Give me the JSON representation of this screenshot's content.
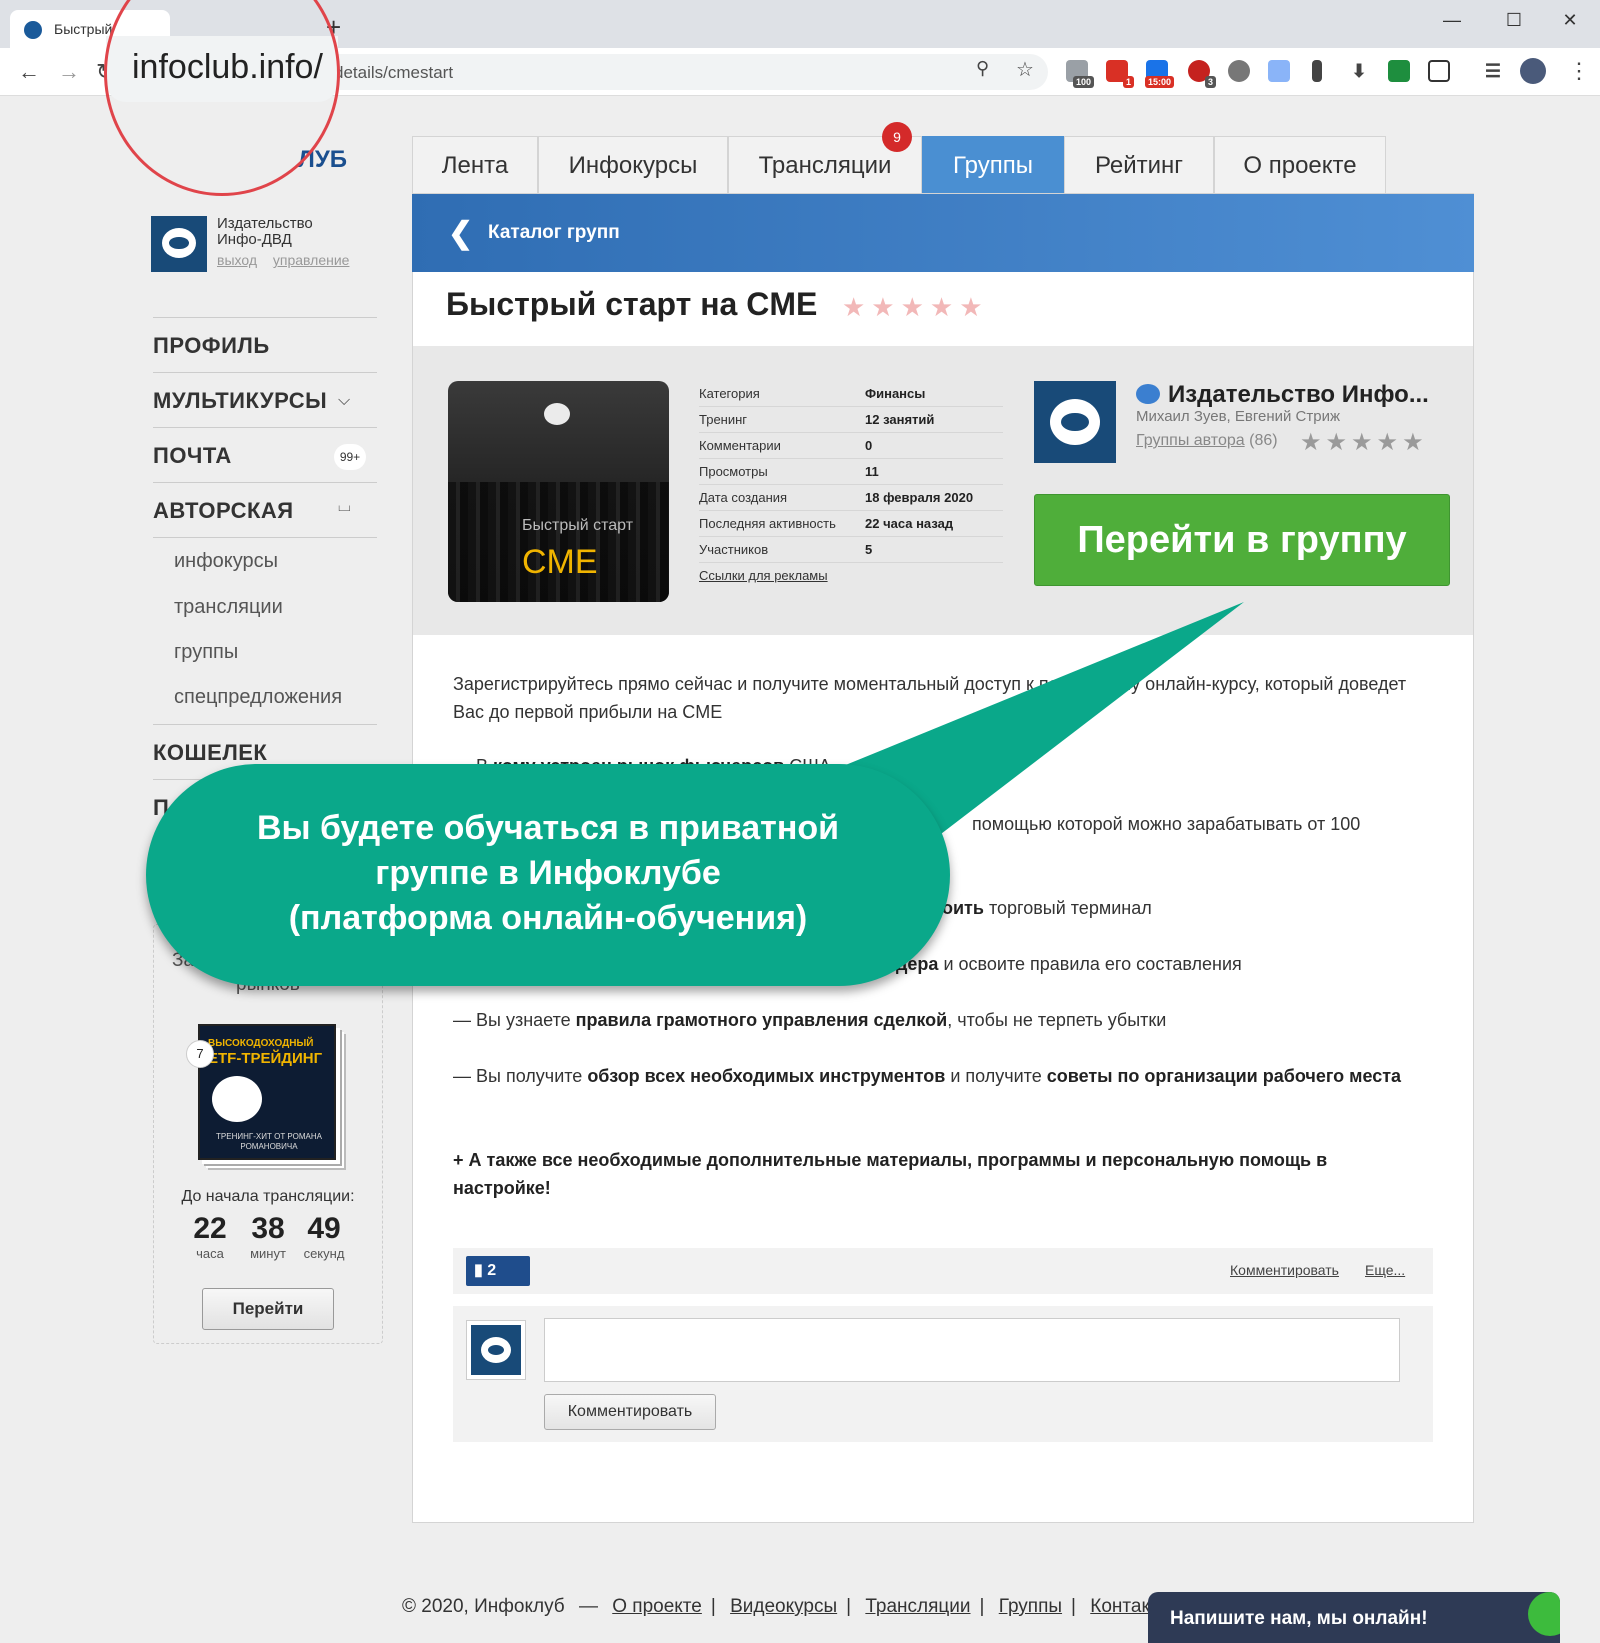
{
  "browser": {
    "tab_title": "Быстрый",
    "new_tab": "+",
    "url_partial": "details/cmestart",
    "zoomed_url": "infoclub.info/",
    "extensions": [
      {
        "name": "counter-100",
        "badge": "100",
        "color": "#9aa0a6"
      },
      {
        "name": "gmail",
        "badge": "1",
        "color": "#d93025"
      },
      {
        "name": "calendar",
        "badge": "15:00",
        "color": "#d93025"
      },
      {
        "name": "adblock",
        "badge": "3",
        "color": "#c5221f"
      }
    ]
  },
  "site": {
    "logo_suffix": "ЛУБ",
    "account_name": "Издательство Инфо-ДВД",
    "logout": "выход",
    "manage": "управление"
  },
  "sidebar": {
    "profile": "ПРОФИЛЬ",
    "multicourses": "МУЛЬТИКУРСЫ",
    "mail": "ПОЧТА",
    "mail_badge": "99+",
    "author": "АВТОРСКАЯ",
    "sub_items": [
      "инфокурсы",
      "трансляции",
      "группы",
      "спецпредложения"
    ],
    "wallet": "КОШЕЛЕК",
    "next_cut": "П"
  },
  "promo": {
    "title_partial": "За",
    "subtitle_partial": "рынков",
    "cover_t1": "ВЫСОКОДОХОДНЫЙ",
    "cover_t2": "ETF-ТРЕЙДИНГ",
    "cover_t3": "ТРЕНИНГ-ХИТ ОТ РОМАНА РОМАНОВИЧА",
    "number": "7",
    "countdown_label": "До начала трансляции:",
    "hours": "22",
    "hours_label": "часа",
    "minutes": "38",
    "minutes_label": "минут",
    "seconds": "49",
    "seconds_label": "секунд",
    "go": "Перейти"
  },
  "tabs": {
    "feed": "Лента",
    "infocourses": "Инфокурсы",
    "broadcasts": "Трансляции",
    "broadcasts_badge": "9",
    "groups": "Группы",
    "rating": "Рейтинг",
    "about": "О проекте"
  },
  "group": {
    "catalog": "Каталог групп",
    "title": "Быстрый старт на CME",
    "title_stars": "★★★★★",
    "rating_stars": 0,
    "cover_line1": "Быстрый старт",
    "cover_line2": "CME",
    "info": [
      {
        "k": "Категория",
        "v": "Финансы"
      },
      {
        "k": "Тренинг",
        "v": "12 занятий"
      },
      {
        "k": "Комментарии",
        "v": "0"
      },
      {
        "k": "Просмотры",
        "v": "11"
      },
      {
        "k": "Дата создания",
        "v": "18 февраля 2020"
      },
      {
        "k": "Последняя активность",
        "v": "22 часа назад"
      },
      {
        "k": "Участников",
        "v": "5"
      }
    ],
    "ads_link": "Ссылки для рекламы",
    "author_name": "Издательство Инфо...",
    "author_people": "Михаил Зуев, Евгений Стриж",
    "author_groups_link": "Группы автора",
    "author_groups_count": "(86)",
    "author_stars": "★★★★★",
    "go_button": "Перейти в группу"
  },
  "description": {
    "intro": "Зарегистрируйтесь прямо сейчас и получите моментальный доступ к пошаговому онлайн-курсу, который доведет Вас до первой прибыли на CME",
    "item1_pre": "— В",
    "item1_bold": "кому устроен рынок фьючерсов",
    "item1_post": "США",
    "item2_tail": "помощью которой можно зарабатывать от 100",
    "item3_bold": "оить",
    "item3_post": "торговый терминал",
    "item4_bold": "дера",
    "item4_post": "и освоите правила его составления",
    "item5_pre": "— Вы узнаете",
    "item5_bold": "правила грамотного управления сделкой",
    "item5_post": ", чтобы не терпеть убытки",
    "item6_pre": "— Вы получите",
    "item6_bold1": "обзор всех необходимых инструментов",
    "item6_mid": "и получите",
    "item6_bold2": "советы по организации рабочего места",
    "bonus": "+ А также все необходимые дополнительные материалы, программы и персональную помощь в настройке!"
  },
  "comments": {
    "stats_count": "2",
    "comment_link": "Комментировать",
    "more_link": "Еще...",
    "comment_button": "Комментировать"
  },
  "footer": {
    "copyright": "© 2020, Инфоклуб",
    "dash": "—",
    "links": [
      "О проекте",
      "Видеокурсы",
      "Трансляции",
      "Группы",
      "Контакт"
    ]
  },
  "chat": {
    "text": "Напишите нам, мы онлайн!"
  },
  "annotation": {
    "line1": "Вы будете обучаться в приватной",
    "line2": "группе в Инфоклубе",
    "line3": "(платформа онлайн-обучения)"
  }
}
